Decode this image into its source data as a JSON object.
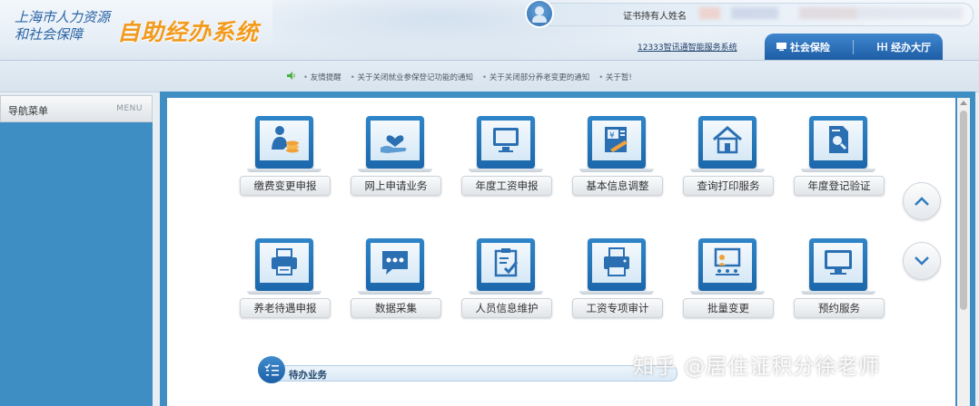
{
  "header": {
    "logo_main": "上海市人力资源和社会保障",
    "logo_sub": "自助经办系统",
    "user_label": "证书持有人姓名",
    "hotline": "12333智讯通智能服务系统",
    "tabs": [
      {
        "label": "社会保险",
        "icon": "computer-icon"
      },
      {
        "label": "经办大厅",
        "icon": "hall-icon"
      }
    ]
  },
  "notice": {
    "items": [
      "友情提醒",
      "关于关闭就业参保登记功能的通知",
      "关于关闭部分养老变更的通知",
      "关于暂!"
    ]
  },
  "sidebar": {
    "title": "导航菜单",
    "menu": "MENU"
  },
  "tiles": [
    {
      "label": "缴费变更申报",
      "icon": "person-coins-icon"
    },
    {
      "label": "网上申请业务",
      "icon": "hand-heart-icon"
    },
    {
      "label": "年度工资申报",
      "icon": "monitor-icon"
    },
    {
      "label": "基本信息调整",
      "icon": "yen-document-icon"
    },
    {
      "label": "查询打印服务",
      "icon": "house-icon"
    },
    {
      "label": "年度登记验证",
      "icon": "document-search-icon"
    },
    {
      "label": "养老待遇申报",
      "icon": "printer-icon"
    },
    {
      "label": "数据采集",
      "icon": "chat-bubble-icon"
    },
    {
      "label": "人员信息维护",
      "icon": "clipboard-check-icon"
    },
    {
      "label": "工资专项审计",
      "icon": "fax-icon"
    },
    {
      "label": "批量变更",
      "icon": "presentation-icon"
    },
    {
      "label": "预约服务",
      "icon": "display-icon"
    }
  ],
  "nav": {
    "up": "chevron-up-icon",
    "down": "chevron-down-icon"
  },
  "pending": {
    "label": "待办业务",
    "icon": "checklist-icon"
  },
  "watermark": "知乎 @居住证积分徐老师",
  "colors": {
    "primary": "#1e5ea6",
    "accent": "#f29a1c",
    "panel": "#3e8ec4"
  }
}
